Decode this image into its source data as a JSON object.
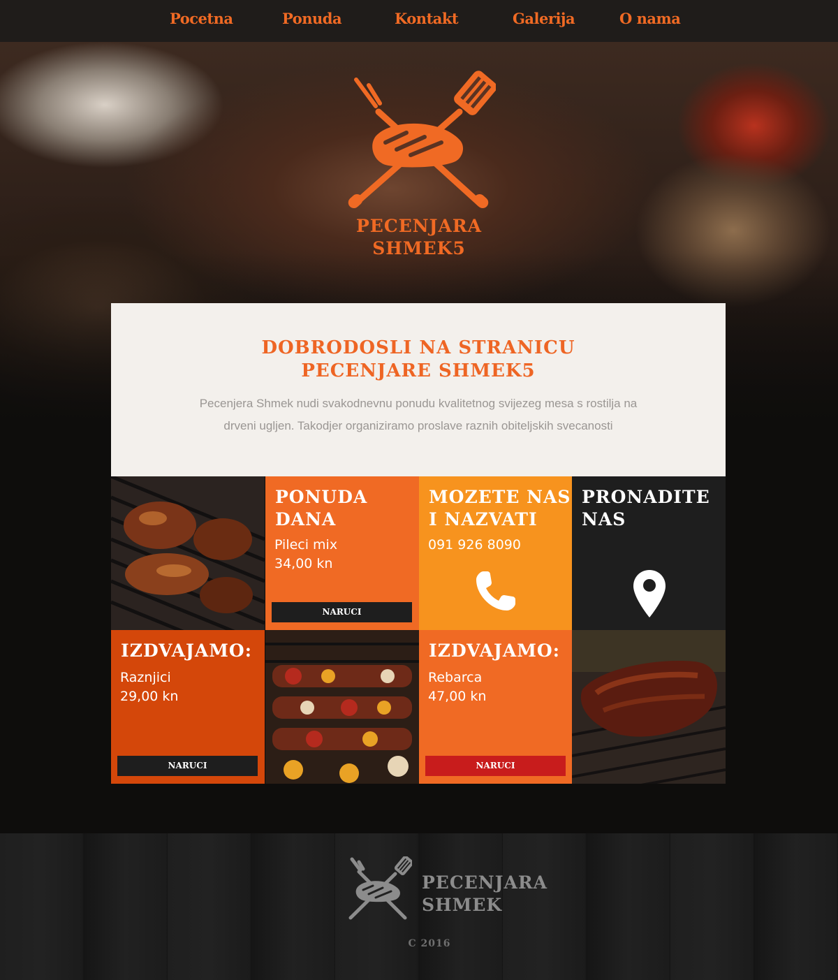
{
  "nav": {
    "items": [
      {
        "label": "Pocetna"
      },
      {
        "label": "Ponuda"
      },
      {
        "label": "Kontakt"
      },
      {
        "label": "Galerija"
      },
      {
        "label": "O nama"
      }
    ]
  },
  "hero": {
    "logo_line1": "PECENJARA",
    "logo_line2": "SHMEK5",
    "logo_icon": "grill-spatula-fork-icon"
  },
  "welcome": {
    "title_line1": "DOBRODOSLI NA STRANICU",
    "title_line2": "PECENJARE SHMEK5",
    "text": "Pecenjera Shmek nudi svakodnevnu ponudu kvalitetnog svijezeg mesa s rostilja na drveni ugljen. Takodjer organiziramo proslave raznih obiteljskih svecanosti"
  },
  "tiles": {
    "daily": {
      "title_line1": "PONUDA",
      "title_line2": "DANA",
      "item": "Pileci mix",
      "price": "34,00 kn",
      "button": "NARUCI"
    },
    "call": {
      "title_line1": "MOZETE NAS",
      "title_line2": "I NAZVATI",
      "phone": "091 926 8090",
      "icon": "phone-icon"
    },
    "find": {
      "title_line1": "PRONADITE",
      "title_line2": "NAS",
      "icon": "map-pin-icon"
    },
    "featured1": {
      "title": "IZDVAJAMO:",
      "item": "Raznjici",
      "price": "29,00 kn",
      "button": "NARUCI"
    },
    "featured2": {
      "title": "IZDVAJAMO:",
      "item": "Rebarca",
      "price": "47,00 kn",
      "button": "NARUCI"
    }
  },
  "footer": {
    "logo_line1": "PECENJARA",
    "logo_line2": "SHMEK",
    "copyright": "C 2016"
  },
  "colors": {
    "accent": "#f06a24",
    "orange_light": "#f7931e",
    "orange_dark": "#d4470a",
    "dark_tile": "#1e1e1e",
    "red_button": "#c81c1c",
    "welcome_bg": "#f3f0ec"
  }
}
